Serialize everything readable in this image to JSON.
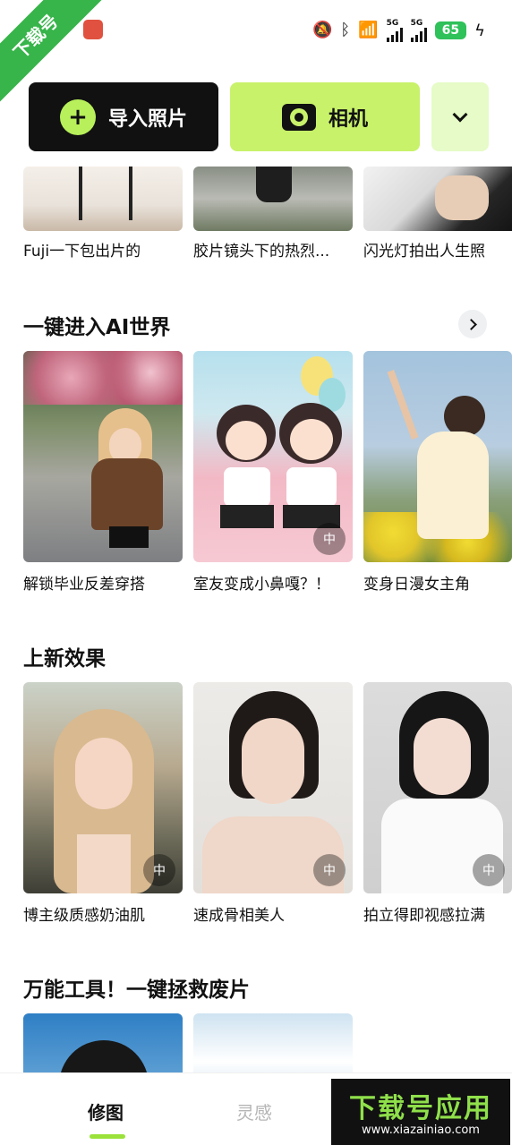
{
  "status_bar": {
    "battery": "65"
  },
  "watermark_corner": "下载号",
  "actions": {
    "import_label": "导入照片",
    "camera_label": "相机"
  },
  "top_row": {
    "items": [
      {
        "caption": "Fuji一下包出片的"
      },
      {
        "caption": "胶片镜头下的热烈..."
      },
      {
        "caption": "闪光灯拍出人生照"
      }
    ]
  },
  "section_ai": {
    "title": "一键进入AI世界",
    "items": [
      {
        "caption": "解锁毕业反差穿搭"
      },
      {
        "caption": "室友变成小鼻嘎？！"
      },
      {
        "caption": "变身日漫女主角"
      }
    ]
  },
  "section_new": {
    "title": "上新效果",
    "items": [
      {
        "caption": "博主级质感奶油肌"
      },
      {
        "caption": "速成骨相美人"
      },
      {
        "caption": "拍立得即视感拉满"
      }
    ]
  },
  "section_tools": {
    "title": "万能工具！一键拯救废片"
  },
  "bottom_nav": {
    "tab_edit": "修图",
    "tab_inspire": "灵感"
  },
  "watermark": {
    "title": "下载号应用",
    "url": "www.xiazainiao.com"
  }
}
